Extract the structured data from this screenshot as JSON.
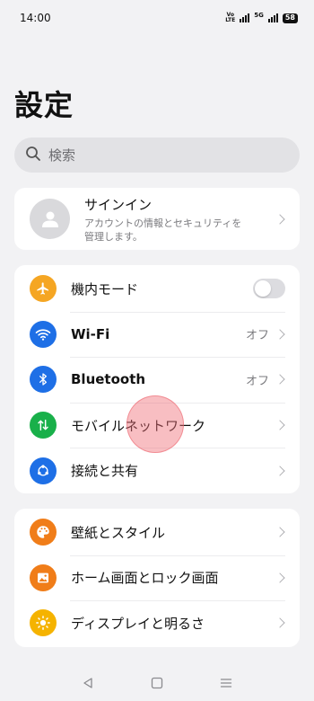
{
  "status_bar": {
    "time": "14:00",
    "volte_top": "Vo",
    "volte_bottom": "LTE",
    "net_5g": "5G",
    "battery": "58"
  },
  "page": {
    "title": "設定"
  },
  "search": {
    "placeholder": "検索"
  },
  "account": {
    "title": "サインイン",
    "subtitle_line1": "アカウントの情報とセキュリティを",
    "subtitle_line2": "管理します。"
  },
  "network_items": [
    {
      "label": "機内モード",
      "icon": "airplane-icon",
      "color": "#f5a623",
      "toggle": false
    },
    {
      "label": "Wi-Fi",
      "icon": "wifi-icon",
      "color": "#1e6fe6",
      "value": "オフ"
    },
    {
      "label": "Bluetooth",
      "icon": "bluetooth-icon",
      "color": "#1e6fe6",
      "value": "オフ"
    },
    {
      "label": "モバイルネットワーク",
      "icon": "mobile-data-icon",
      "color": "#19b04a"
    },
    {
      "label": "接続と共有",
      "icon": "share-icon",
      "color": "#1e6fe6"
    }
  ],
  "display_items": [
    {
      "label": "壁紙とスタイル",
      "icon": "palette-icon",
      "color": "#f07d19"
    },
    {
      "label": "ホーム画面とロック画面",
      "icon": "image-icon",
      "color": "#f07d19"
    },
    {
      "label": "ディスプレイと明るさ",
      "icon": "brightness-icon",
      "color": "#f5b300"
    }
  ],
  "colors": {
    "background": "#f2f2f4",
    "card": "#ffffff",
    "tap_indicator": "#f06e78"
  }
}
